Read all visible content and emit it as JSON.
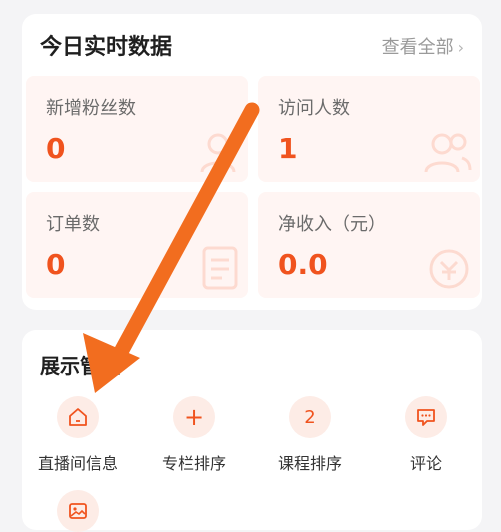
{
  "stats": {
    "title": "今日实时数据",
    "view_all": "查看全部",
    "tiles": [
      {
        "label": "新增粉丝数",
        "value": "0",
        "icon": "user-icon"
      },
      {
        "label": "访问人数",
        "value": "1",
        "icon": "users-icon"
      },
      {
        "label": "订单数",
        "value": "0",
        "icon": "order-icon"
      },
      {
        "label": "净收入（元）",
        "value": "0.0",
        "icon": "wallet-icon"
      }
    ]
  },
  "display": {
    "title": "展示管理",
    "tools": [
      {
        "label": "直播间信息",
        "icon": "home-icon",
        "glyph": ""
      },
      {
        "label": "专栏排序",
        "icon": "plus-icon",
        "glyph": "+"
      },
      {
        "label": "课程排序",
        "icon": "number-two-icon",
        "glyph": "2"
      },
      {
        "label": "评论",
        "icon": "comment-icon",
        "glyph": ""
      },
      {
        "label": "",
        "icon": "image-icon",
        "glyph": ""
      }
    ]
  },
  "colors": {
    "accent": "#f0531e",
    "tile_bg": "#fff5f3",
    "icon_circle_bg": "#fdece6",
    "annotation_arrow": "#f26d1f"
  }
}
